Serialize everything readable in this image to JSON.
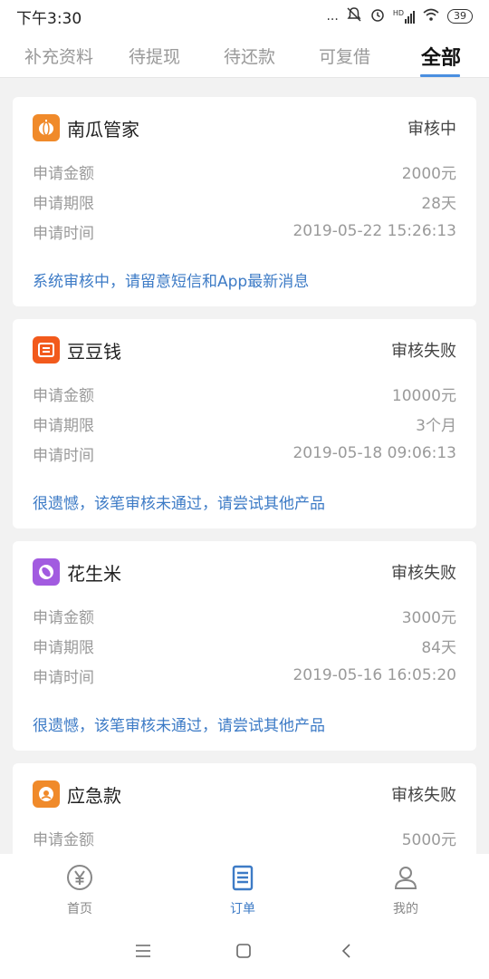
{
  "status_bar": {
    "time": "下午3:30",
    "dots": "...",
    "network": "HD",
    "battery": "39"
  },
  "tabs": [
    {
      "label": "补充资料",
      "active": false
    },
    {
      "label": "待提现",
      "active": false
    },
    {
      "label": "待还款",
      "active": false
    },
    {
      "label": "可复借",
      "active": false
    },
    {
      "label": "全部",
      "active": true
    }
  ],
  "orders": [
    {
      "name": "南瓜管家",
      "status": "审核中",
      "logo_color": "#f08a2a",
      "logo_icon": "pumpkin-icon",
      "rows": [
        {
          "label": "申请金额",
          "value": "2000元"
        },
        {
          "label": "申请期限",
          "value": "28天"
        },
        {
          "label": "申请时间",
          "value": "2019-05-22 15:26:13"
        }
      ],
      "notice": "系统审核中，请留意短信和App最新消息"
    },
    {
      "name": "豆豆钱",
      "status": "审核失败",
      "logo_color": "#f25a1c",
      "logo_icon": "doudou-icon",
      "rows": [
        {
          "label": "申请金额",
          "value": "10000元"
        },
        {
          "label": "申请期限",
          "value": "3个月"
        },
        {
          "label": "申请时间",
          "value": "2019-05-18 09:06:13"
        }
      ],
      "notice": "很遗憾，该笔审核未通过，请尝试其他产品"
    },
    {
      "name": "花生米",
      "status": "审核失败",
      "logo_color": "#a25be0",
      "logo_icon": "peanut-icon",
      "rows": [
        {
          "label": "申请金额",
          "value": "3000元"
        },
        {
          "label": "申请期限",
          "value": "84天"
        },
        {
          "label": "申请时间",
          "value": "2019-05-16 16:05:20"
        }
      ],
      "notice": "很遗憾，该笔审核未通过，请尝试其他产品"
    },
    {
      "name": "应急款",
      "status": "审核失败",
      "logo_color": "#f08a2a",
      "logo_icon": "emergency-icon",
      "rows": [
        {
          "label": "申请金额",
          "value": "5000元"
        }
      ],
      "notice": ""
    }
  ],
  "bottom_nav": [
    {
      "label": "首页",
      "icon": "yen-coin-icon",
      "active": false
    },
    {
      "label": "订单",
      "icon": "clipboard-icon",
      "active": true
    },
    {
      "label": "我的",
      "icon": "person-icon",
      "active": false
    }
  ],
  "colors": {
    "accent": "#3d7bc6",
    "tab_indicator": "#4a8fe0"
  }
}
